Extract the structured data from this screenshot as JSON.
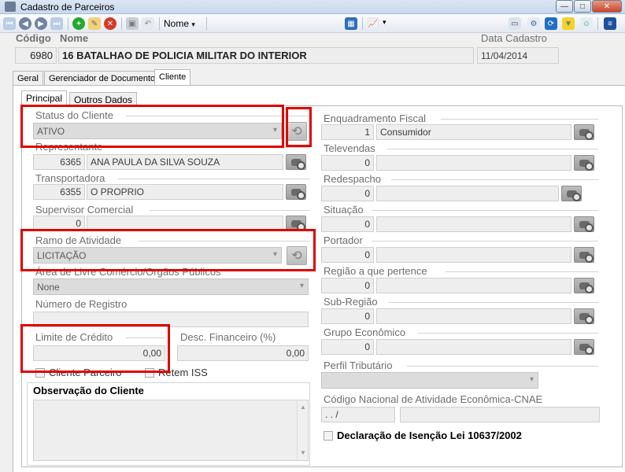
{
  "window": {
    "title": "Cadastro de Parceiros",
    "minimize": "—",
    "maximize": "□",
    "close": "✕"
  },
  "toolbar": {
    "nome_label": "Nome",
    "nome_arrow": "▾",
    "chart_arrow": "▾"
  },
  "header": {
    "codigo_label": "Código",
    "nome_label": "Nome",
    "data_cadastro_label": "Data Cadastro",
    "codigo_value": "6980",
    "nome_value": "16 BATALHAO DE POLICIA MILITAR DO INTERIOR",
    "data_cadastro_value": "11/04/2014"
  },
  "tabs": [
    "Geral",
    "Gerenciador de Documentos",
    "Cliente"
  ],
  "subtabs": [
    "Principal",
    "Outros Dados"
  ],
  "left": {
    "status_label": "Status do Cliente",
    "status_value": "ATIVO",
    "representante_label": "Representante",
    "representante_code": "6365",
    "representante_name": "ANA PAULA DA SILVA SOUZA",
    "transportadora_label": "Transportadora",
    "transportadora_code": "6355",
    "transportadora_name": "O PROPRIO",
    "supervisor_label": "Supervisor Comercial",
    "supervisor_code": "0",
    "ramo_label": "Ramo de Atividade",
    "ramo_value": "LICITAÇÃO",
    "area_label": "Área de Livre Comércio/Orgãos Públicos",
    "area_value": "None",
    "numero_registro_label": "Número de Registro",
    "limite_label": "Limite de Crédito",
    "limite_value": "0,00",
    "desc_label": "Desc. Financeiro (%)",
    "desc_value": "0,00",
    "cliente_parceiro_label": "Cliente Parceiro",
    "retem_iss_label": "Retem ISS",
    "observacao_label": "Observação do Cliente"
  },
  "right": {
    "enquadramento_label": "Enquadramento Fiscal",
    "enquadramento_code": "1",
    "enquadramento_name": "Consumidor",
    "televendas_label": "Televendas",
    "televendas_code": "0",
    "redespacho_label": "Redespacho",
    "redespacho_code": "0",
    "situacao_label": "Situação",
    "situacao_code": "0",
    "portador_label": "Portador",
    "portador_code": "0",
    "regiao_label": "Região a que pertence",
    "regiao_code": "0",
    "subregiao_label": "Sub-Região",
    "subregiao_code": "0",
    "grupo_label": "Grupo Econômico",
    "grupo_code": "0",
    "perfil_label": "Perfil Tributário",
    "cnae_label": "Código Nacional de Atividade Econômica-CNAE",
    "cnae_value": ". . /",
    "declaracao_label": "Declaração de Isenção Lei 10637/2002"
  },
  "colors": {
    "highlight": "#e00000",
    "toolbar_first": "#4a8fd6",
    "add": "#27a82e",
    "delete": "#d43a2a"
  }
}
